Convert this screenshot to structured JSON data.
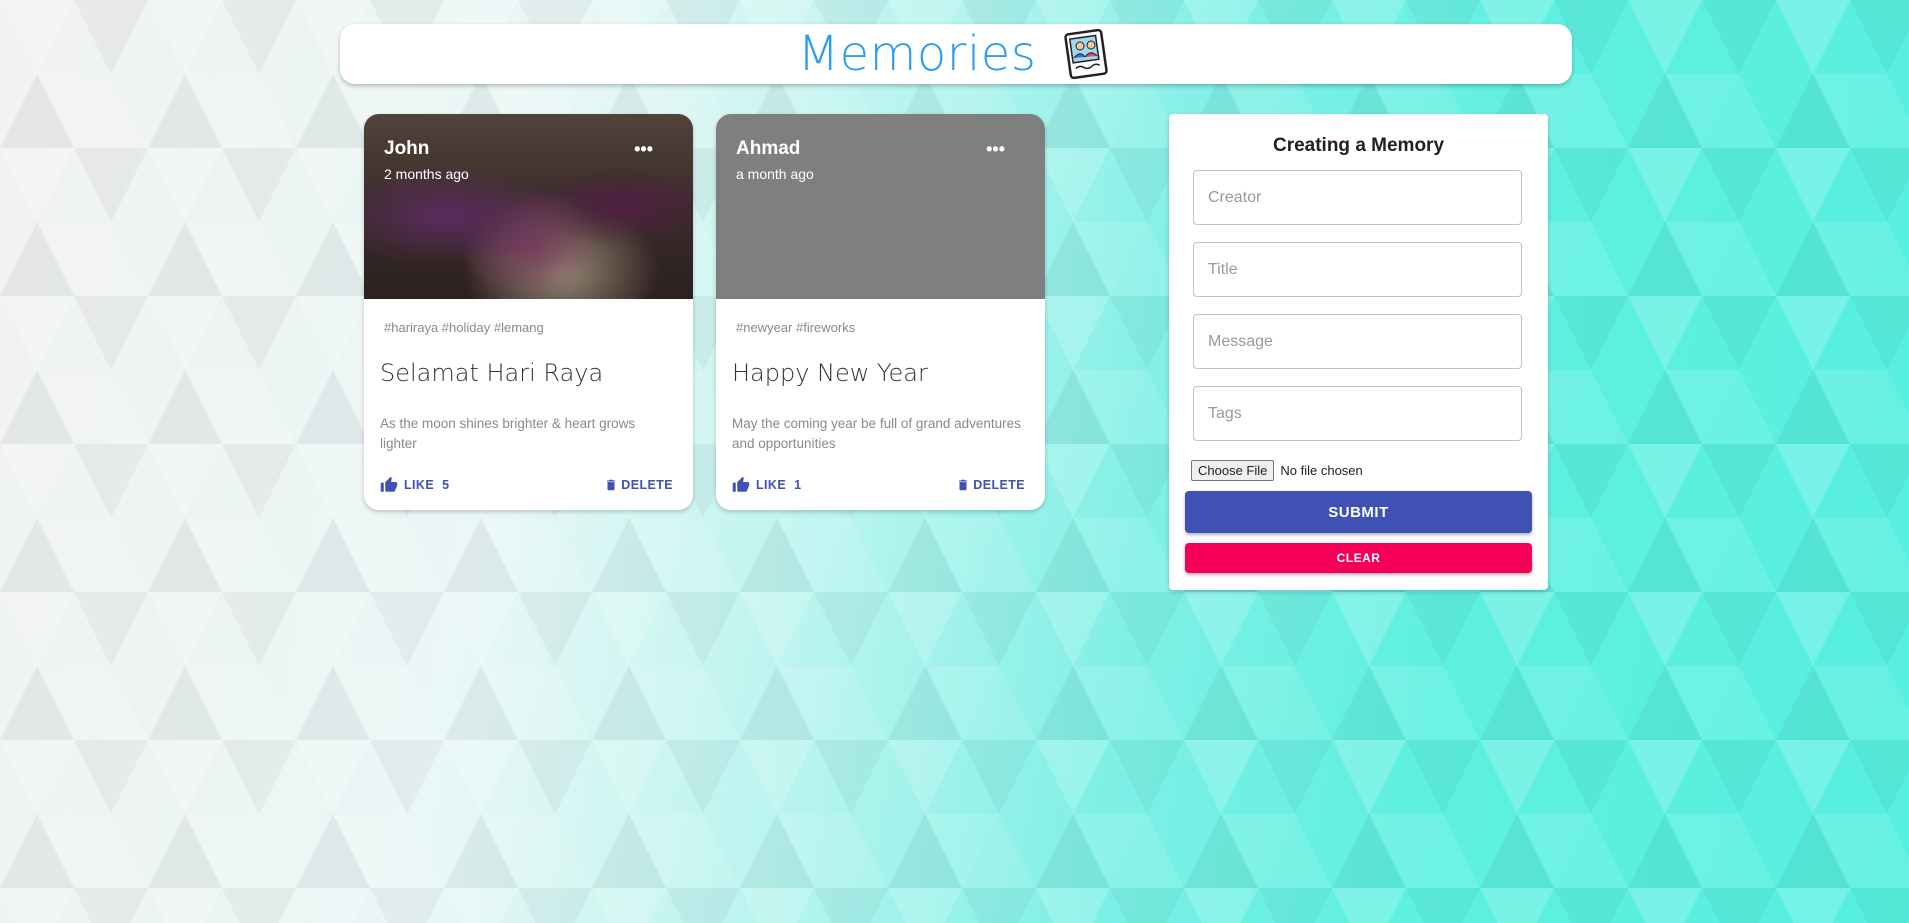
{
  "app": {
    "title": "Memories"
  },
  "posts": [
    {
      "author": "John",
      "time": "2 months ago",
      "tags": "#hariraya #holiday #lemang",
      "title": "Selamat Hari Raya",
      "message": "As the moon shines brighter & heart grows lighter",
      "like_label": "LIKE",
      "like_count": "5",
      "delete_label": "DELETE",
      "more_label": "•••"
    },
    {
      "author": "Ahmad",
      "time": "a month ago",
      "tags": "#newyear #fireworks",
      "title": "Happy New Year",
      "message": "May the coming year be full of grand adventures and opportunities",
      "like_label": "LIKE",
      "like_count": "1",
      "delete_label": "DELETE",
      "more_label": "•••"
    }
  ],
  "form": {
    "title": "Creating a Memory",
    "creator_placeholder": "Creator",
    "title_placeholder": "Title",
    "message_placeholder": "Message",
    "tags_placeholder": "Tags",
    "file_button": "Choose File",
    "file_status": "No file chosen",
    "submit_label": "SUBMIT",
    "clear_label": "CLEAR"
  },
  "colors": {
    "accent": "#3f51b5",
    "secondary": "#f50057",
    "title_blue": "#2a9df4"
  }
}
